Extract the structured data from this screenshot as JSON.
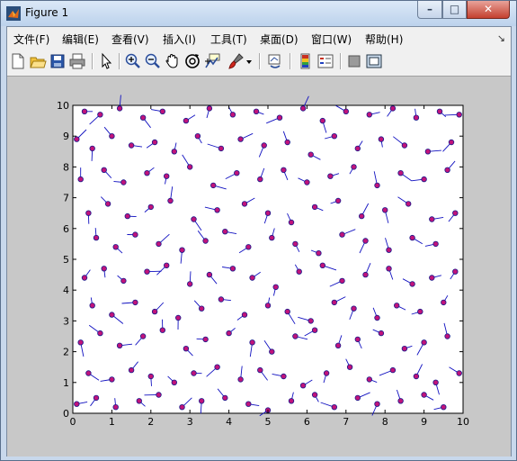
{
  "window": {
    "title": "Figure 1",
    "min_label": "–",
    "max_label": "□",
    "close_label": "✕"
  },
  "menu": {
    "items": [
      {
        "label": "文件(F)"
      },
      {
        "label": "编辑(E)"
      },
      {
        "label": "查看(V)"
      },
      {
        "label": "插入(I)"
      },
      {
        "label": "工具(T)"
      },
      {
        "label": "桌面(D)"
      },
      {
        "label": "窗口(W)"
      },
      {
        "label": "帮助(H)"
      }
    ],
    "dock_arrow": "↘"
  },
  "toolbar": {
    "icons": [
      "new-figure-icon",
      "open-file-icon",
      "save-icon",
      "print-icon",
      "pointer-icon",
      "zoom-in-icon",
      "zoom-out-icon",
      "pan-hand-icon",
      "rotate-3d-icon",
      "data-cursor-icon",
      "brush-icon",
      "brush-dropdown-icon",
      "link-plot-icon",
      "colorbar-icon",
      "legend-icon",
      "hide-plot-tools-icon",
      "show-plot-tools-icon"
    ]
  },
  "colors": {
    "marker_face": "#c0137a",
    "marker_edge": "#1a1a8c",
    "stem": "#1010c0",
    "axes_bg": "#ffffff",
    "figure_bg": "#c8c8c8"
  },
  "chart_data": {
    "type": "scatter",
    "title": "",
    "xlabel": "",
    "ylabel": "",
    "xlim": [
      0,
      10
    ],
    "ylim": [
      0,
      10
    ],
    "xticks": [
      "0",
      "1",
      "2",
      "3",
      "4",
      "5",
      "6",
      "7",
      "8",
      "9",
      "10"
    ],
    "yticks": [
      "0",
      "1",
      "2",
      "3",
      "4",
      "5",
      "6",
      "7",
      "8",
      "9",
      "10"
    ],
    "grid": false,
    "marker": "circle-with-direction-stem",
    "series": [
      {
        "x": [
          0.3,
          0.7,
          1.2,
          1.8,
          2.3,
          2.9,
          3.5,
          4.1,
          4.7,
          5.3,
          5.9,
          6.4,
          7.0,
          7.6,
          8.2,
          8.8,
          9.4,
          9.9,
          0.1,
          0.5,
          1.0,
          1.5,
          2.1,
          2.6,
          3.2,
          3.8,
          4.3,
          4.9,
          5.5,
          6.1,
          6.7,
          7.3,
          7.9,
          8.5,
          9.1,
          9.7,
          0.2,
          0.8,
          1.3,
          1.9,
          2.4,
          3.0,
          3.6,
          4.2,
          4.8,
          5.4,
          6.0,
          6.6,
          7.2,
          7.8,
          8.4,
          9.0,
          9.6,
          0.4,
          0.9,
          1.4,
          2.0,
          2.5,
          3.1,
          3.7,
          4.4,
          5.0,
          5.6,
          6.2,
          6.8,
          7.4,
          8.0,
          8.6,
          9.2,
          9.8,
          0.6,
          1.1,
          1.6,
          2.2,
          2.8,
          3.4,
          3.9,
          4.5,
          5.1,
          5.7,
          6.3,
          6.9,
          7.5,
          8.1,
          8.7,
          9.3,
          0.3,
          0.8,
          1.3,
          1.9,
          2.4,
          3.0,
          3.5,
          4.1,
          4.6,
          5.2,
          5.8,
          6.4,
          6.9,
          7.5,
          8.1,
          8.7,
          9.2,
          9.8,
          0.5,
          1.0,
          1.6,
          2.1,
          2.7,
          3.3,
          3.8,
          4.4,
          5.0,
          5.5,
          6.1,
          6.7,
          7.2,
          7.8,
          8.3,
          8.9,
          9.5,
          0.2,
          0.7,
          1.2,
          1.8,
          2.3,
          2.9,
          3.4,
          4.0,
          4.6,
          5.1,
          5.7,
          6.2,
          6.8,
          7.3,
          7.9,
          8.5,
          9.0,
          9.6,
          0.4,
          1.0,
          1.5,
          2.0,
          2.6,
          3.1,
          3.7,
          4.3,
          4.8,
          5.4,
          5.9,
          6.5,
          7.1,
          7.6,
          8.2,
          8.8,
          9.3,
          9.9,
          0.1,
          0.6,
          1.1,
          1.7,
          2.2,
          2.8,
          3.3,
          3.9,
          4.5,
          5.0,
          5.6,
          6.2,
          6.7,
          7.3,
          7.8,
          8.4,
          9.0,
          9.5
        ],
        "y": [
          9.8,
          9.7,
          9.9,
          9.6,
          9.8,
          9.5,
          9.9,
          9.7,
          9.8,
          9.6,
          9.9,
          9.5,
          9.8,
          9.7,
          9.9,
          9.6,
          9.8,
          9.7,
          8.9,
          8.6,
          9.0,
          8.7,
          8.8,
          8.5,
          9.0,
          8.6,
          8.9,
          8.7,
          8.8,
          8.4,
          9.0,
          8.6,
          8.9,
          8.7,
          8.5,
          8.8,
          7.6,
          7.9,
          7.5,
          7.8,
          7.7,
          8.0,
          7.4,
          7.8,
          7.6,
          7.9,
          7.5,
          7.7,
          8.0,
          7.4,
          7.8,
          7.6,
          7.9,
          6.5,
          6.8,
          6.4,
          6.7,
          6.9,
          6.3,
          6.6,
          6.8,
          6.5,
          6.2,
          6.7,
          6.9,
          6.4,
          6.6,
          6.8,
          6.3,
          6.5,
          5.7,
          5.4,
          5.8,
          5.5,
          5.3,
          5.6,
          5.9,
          5.4,
          5.7,
          5.5,
          5.2,
          5.8,
          5.6,
          5.3,
          5.7,
          5.5,
          4.4,
          4.7,
          4.3,
          4.6,
          4.8,
          4.2,
          4.5,
          4.7,
          4.4,
          4.1,
          4.6,
          4.8,
          4.3,
          4.5,
          4.7,
          4.2,
          4.4,
          4.6,
          3.5,
          3.2,
          3.6,
          3.3,
          3.1,
          3.4,
          3.7,
          3.2,
          3.5,
          3.3,
          3.0,
          3.6,
          3.4,
          3.1,
          3.5,
          3.3,
          3.6,
          2.3,
          2.6,
          2.2,
          2.5,
          2.7,
          2.1,
          2.4,
          2.6,
          2.3,
          2.0,
          2.5,
          2.7,
          2.2,
          2.4,
          2.6,
          2.1,
          2.3,
          2.5,
          1.3,
          1.1,
          1.4,
          1.2,
          1.0,
          1.3,
          1.5,
          1.1,
          1.4,
          1.2,
          0.9,
          1.3,
          1.5,
          1.1,
          1.4,
          1.2,
          1.0,
          1.3,
          0.3,
          0.5,
          0.2,
          0.4,
          0.6,
          0.2,
          0.4,
          0.5,
          0.3,
          0.1,
          0.4,
          0.6,
          0.2,
          0.5,
          0.3,
          0.4,
          0.6,
          0.2
        ]
      }
    ]
  }
}
